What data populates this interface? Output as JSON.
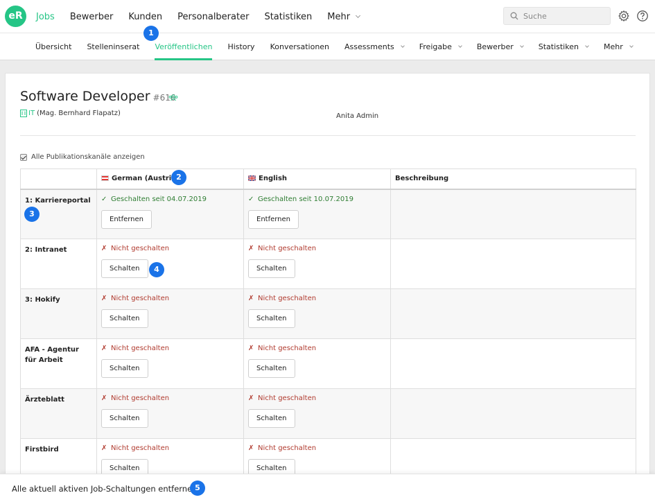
{
  "app": {
    "logo_text": "eR",
    "brand_color": "#25c586"
  },
  "main_nav": [
    {
      "label": "Jobs",
      "active": true
    },
    {
      "label": "Bewerber"
    },
    {
      "label": "Kunden"
    },
    {
      "label": "Personalberater"
    },
    {
      "label": "Statistiken"
    },
    {
      "label": "Mehr",
      "dropdown": true
    }
  ],
  "search": {
    "placeholder": "Suche",
    "icon": "search-icon"
  },
  "header_icons": [
    "gear-icon",
    "help-icon"
  ],
  "sub_nav": [
    {
      "label": "Übersicht"
    },
    {
      "label": "Stelleninserat"
    },
    {
      "label": "Veröffentlichen",
      "active": true
    },
    {
      "label": "History"
    },
    {
      "label": "Konversationen"
    },
    {
      "label": "Assessments",
      "dropdown": true
    },
    {
      "label": "Freigabe",
      "dropdown": true
    },
    {
      "label": "Bewerber",
      "dropdown": true
    },
    {
      "label": "Statistiken",
      "dropdown": true
    },
    {
      "label": "Mehr",
      "dropdown": true
    }
  ],
  "job": {
    "title": "Software Developer",
    "number": "#616",
    "department_code": "IT",
    "department_person": "(Mag. Bernhard Flapatz)",
    "owner": "Anita Admin"
  },
  "show_all_channels": {
    "label": "Alle Publikationskanäle anzeigen",
    "checked": true
  },
  "table": {
    "headers": [
      "",
      "German (Austria)",
      "English",
      "Beschreibung"
    ],
    "rows": [
      {
        "channel": "1: Karriereportal",
        "german": {
          "status": "Geschalten seit 04.07.2019",
          "published": true,
          "button": "Entfernen"
        },
        "english": {
          "status": "Geschalten seit 10.07.2019",
          "published": true,
          "button": "Entfernen"
        },
        "description": ""
      },
      {
        "channel": "2: Intranet",
        "german": {
          "status": "Nicht geschalten",
          "published": false,
          "button": "Schalten"
        },
        "english": {
          "status": "Nicht geschalten",
          "published": false,
          "button": "Schalten"
        },
        "description": ""
      },
      {
        "channel": "3: Hokify",
        "german": {
          "status": "Nicht geschalten",
          "published": false,
          "button": "Schalten"
        },
        "english": {
          "status": "Nicht geschalten",
          "published": false,
          "button": "Schalten"
        },
        "description": ""
      },
      {
        "channel": "AFA - Agentur für Arbeit",
        "german": {
          "status": "Nicht geschalten",
          "published": false,
          "button": "Schalten"
        },
        "english": {
          "status": "Nicht geschalten",
          "published": false,
          "button": "Schalten"
        },
        "description": ""
      },
      {
        "channel": "Ärzteblatt",
        "german": {
          "status": "Nicht geschalten",
          "published": false,
          "button": "Schalten"
        },
        "english": {
          "status": "Nicht geschalten",
          "published": false,
          "button": "Schalten"
        },
        "description": ""
      },
      {
        "channel": "Firstbird",
        "german": {
          "status": "Nicht geschalten",
          "published": false,
          "button": "Schalten"
        },
        "english": {
          "status": "Nicht geschalten",
          "published": false,
          "button": "Schalten"
        },
        "description": ""
      }
    ]
  },
  "bottom_action": "Alle aktuell aktiven Job-Schaltungen entfernen",
  "callouts": [
    "1",
    "2",
    "3",
    "4",
    "5"
  ],
  "colors": {
    "published": "#2e7d32",
    "unpublished": "#b03a2e",
    "callout": "#1a73e8"
  }
}
